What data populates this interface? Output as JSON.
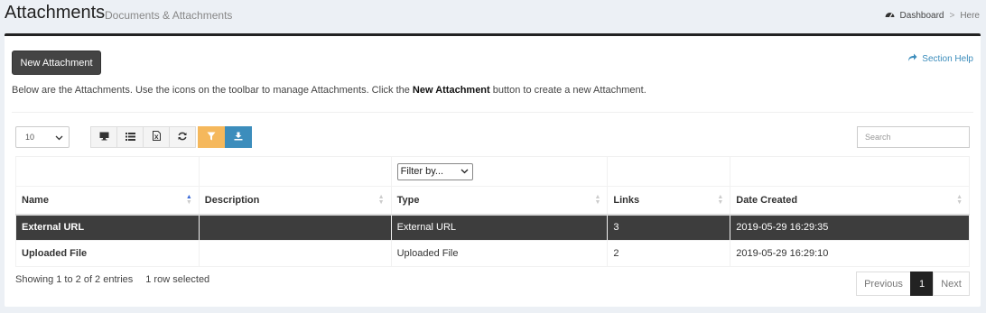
{
  "header": {
    "title": "Attachments",
    "subtitle": "Documents & Attachments",
    "breadcrumb": {
      "home": "Dashboard",
      "sep": ">",
      "current": "Here"
    }
  },
  "toolbar": {
    "new_button": "New Attachment",
    "section_help": "Section Help",
    "intro_before": "Below are the Attachments. Use the icons on the toolbar to manage Attachments. Click the ",
    "intro_bold": "New Attachment",
    "intro_after": " button to create a new Attachment.",
    "page_length": "10",
    "search_placeholder": "Search",
    "icons": [
      "monitor-icon",
      "list-icon",
      "excel-icon",
      "refresh-icon",
      "filter-icon",
      "download-icon"
    ]
  },
  "table": {
    "filter_label": "Filter by...",
    "columns": [
      "Name",
      "Description",
      "Type",
      "Links",
      "Date Created"
    ],
    "rows": [
      {
        "name": "External URL",
        "description": "",
        "type": "External URL",
        "links": "3",
        "date": "2019-05-29 16:29:35",
        "selected": true
      },
      {
        "name": "Uploaded File",
        "description": "",
        "type": "Uploaded File",
        "links": "2",
        "date": "2019-05-29 16:29:10",
        "selected": false
      }
    ]
  },
  "footer": {
    "showing": "Showing 1 to 2 of 2 entries",
    "selected": "1 row selected",
    "prev": "Previous",
    "page": "1",
    "next": "Next"
  },
  "colors": {
    "accent": "#3c8dbc",
    "warning": "#f5b85c",
    "selected_row": "#3d3d3d"
  }
}
